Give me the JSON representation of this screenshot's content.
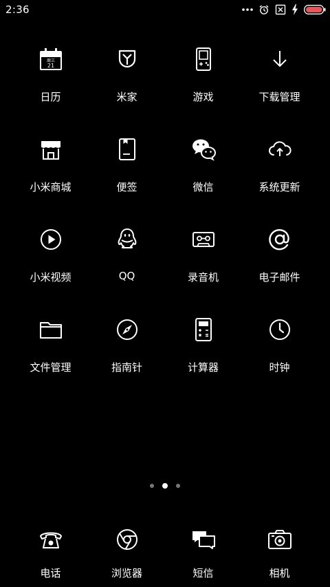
{
  "status_bar": {
    "time": "2:36",
    "icons": [
      "more-dots-icon",
      "alarm-icon",
      "sim-off-icon",
      "charging-icon",
      "battery-icon"
    ],
    "battery_color": "#e6565a"
  },
  "apps": [
    {
      "label": "日历",
      "icon": "calendar-icon",
      "date_text": "周三",
      "date_num": "21"
    },
    {
      "label": "米家",
      "icon": "mijia-icon"
    },
    {
      "label": "游戏",
      "icon": "game-icon"
    },
    {
      "label": "下载管理",
      "icon": "download-icon"
    },
    {
      "label": "小米商城",
      "icon": "store-icon"
    },
    {
      "label": "便签",
      "icon": "notes-icon"
    },
    {
      "label": "微信",
      "icon": "wechat-icon"
    },
    {
      "label": "系统更新",
      "icon": "cloud-upload-icon"
    },
    {
      "label": "小米视频",
      "icon": "video-icon"
    },
    {
      "label": "QQ",
      "icon": "qq-icon"
    },
    {
      "label": "录音机",
      "icon": "recorder-icon"
    },
    {
      "label": "电子邮件",
      "icon": "email-icon"
    },
    {
      "label": "文件管理",
      "icon": "folder-icon"
    },
    {
      "label": "指南针",
      "icon": "compass-icon"
    },
    {
      "label": "计算器",
      "icon": "calculator-icon"
    },
    {
      "label": "时钟",
      "icon": "clock-icon"
    }
  ],
  "page_indicator": {
    "total": 3,
    "active": 2
  },
  "dock": [
    {
      "label": "电话",
      "icon": "phone-icon"
    },
    {
      "label": "浏览器",
      "icon": "browser-icon"
    },
    {
      "label": "短信",
      "icon": "messages-icon"
    },
    {
      "label": "相机",
      "icon": "camera-icon"
    }
  ]
}
